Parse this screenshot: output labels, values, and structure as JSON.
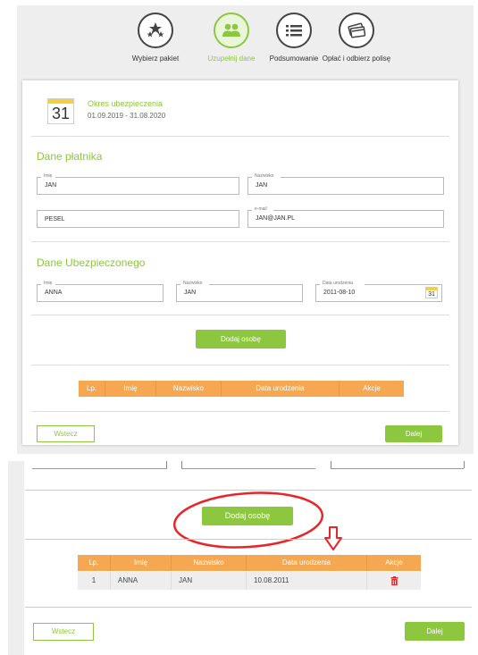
{
  "steps": [
    {
      "label": "Wybierz pakiet",
      "icon": "stars-icon"
    },
    {
      "label": "Uzupełnij dane",
      "icon": "users-icon"
    },
    {
      "label": "Podsumowanie",
      "icon": "list-icon"
    },
    {
      "label": "Opłać i odbierz polisę",
      "icon": "cards-icon"
    }
  ],
  "period": {
    "calendar_day": "31",
    "title": "Okres ubezpieczenia",
    "dates": "01.09.2019 - 31.08.2020"
  },
  "payer": {
    "section_title": "Dane płatnika",
    "first_name_label": "Imię",
    "first_name": "JAN",
    "last_name_label": "Nazwisko",
    "last_name": "JAN",
    "pesel_placeholder": "PESEL",
    "email_label": "e-mail",
    "email": "JAN@JAN.PL"
  },
  "insured": {
    "section_title": "Dane Ubezpieczonego",
    "first_name_label": "Imię",
    "first_name": "ANNA",
    "last_name_label": "Nazwisko",
    "last_name": "JAN",
    "birth_label": "Data urodzenia",
    "birth_date": "2011-08-10",
    "cal_day": "31"
  },
  "add_person_label": "Dodaj osobę",
  "table": {
    "headers": [
      "Lp.",
      "Imię",
      "Nazwisko",
      "Data urodzenia",
      "Akcje"
    ],
    "rows": [
      {
        "lp": "1",
        "first_name": "ANNA",
        "last_name": "JAN",
        "birth_date": "10.08.2011"
      }
    ]
  },
  "nav": {
    "back_label": "Wstecz",
    "next_label": "Dalej"
  },
  "colors": {
    "accent": "#8dc63f",
    "table_header": "#f5a851",
    "annotation": "#e8262a"
  }
}
